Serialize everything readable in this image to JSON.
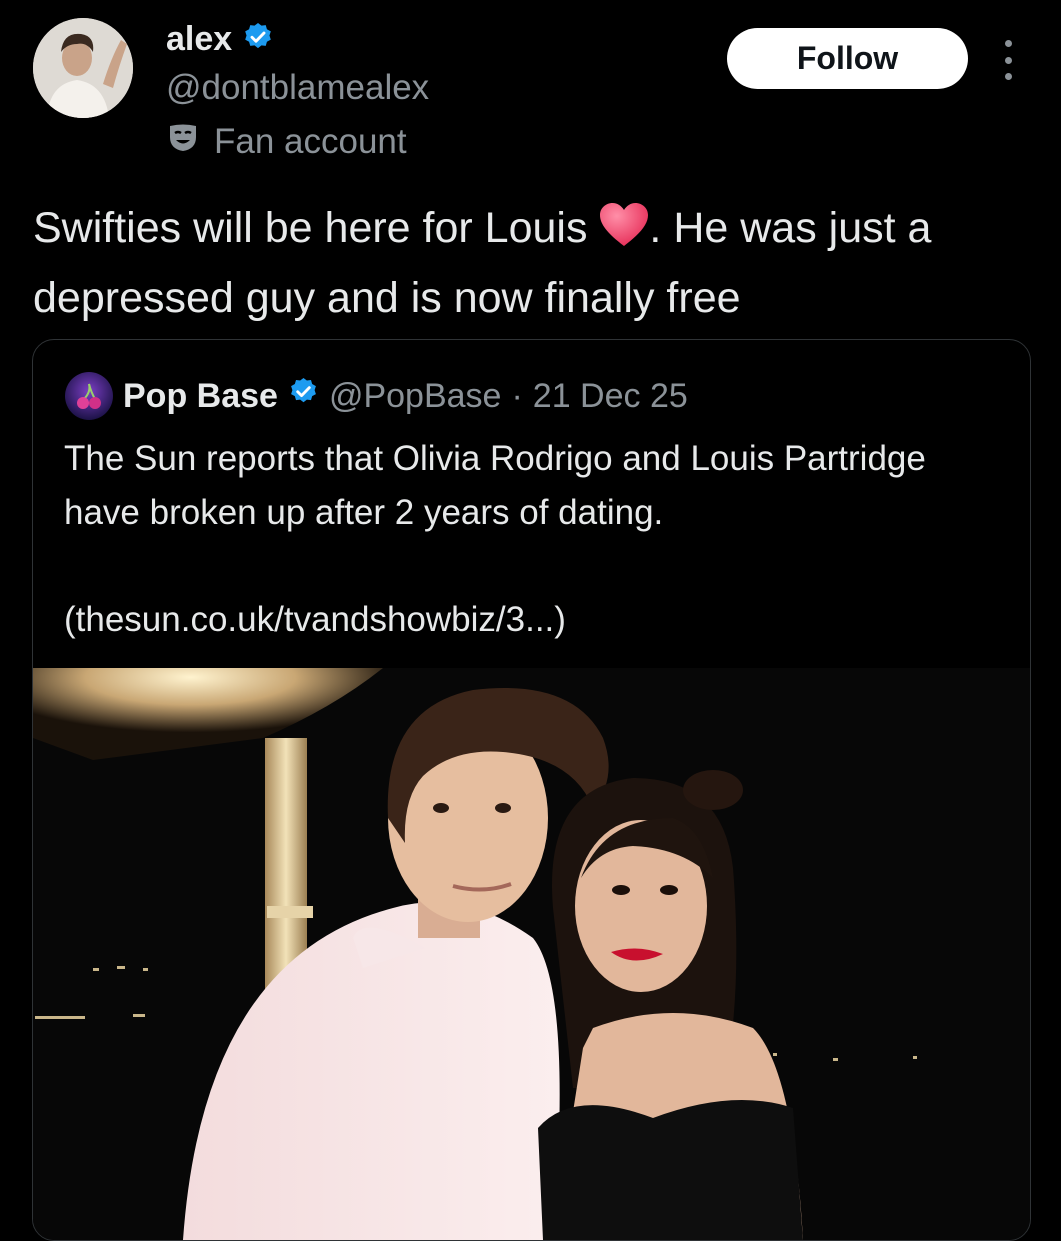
{
  "author": {
    "name": "alex",
    "handle": "@dontblamealex",
    "label": "Fan account",
    "verified": true,
    "verified_color": "#1d9bf0"
  },
  "actions": {
    "follow_label": "Follow"
  },
  "tweet": {
    "text_before_emoji": "Swifties will be here for Louis ",
    "emoji": "heart",
    "text_after_emoji": ". He was just a depressed guy and is now finally free"
  },
  "quoted": {
    "name": "Pop Base",
    "handle": "@PopBase",
    "separator": "·",
    "date": "21 Dec 25",
    "verified": true,
    "text": "The Sun reports that Olivia Rodrigo and Louis Partridge have broken up after 2 years of dating.",
    "link": "(thesun.co.uk/tvandshowbiz/3...)"
  },
  "icons": [
    "verified-badge-icon",
    "theater-mask-icon",
    "more-options-icon",
    "red-heart-icon"
  ]
}
